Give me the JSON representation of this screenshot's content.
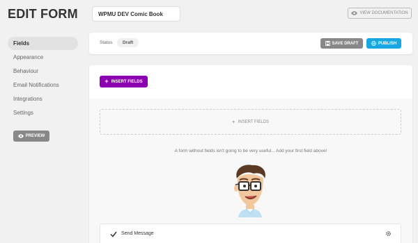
{
  "header": {
    "title": "EDIT FORM",
    "form_name": "WPMU DEV Comic Book",
    "view_docs_label": "VIEW DOCUMENTATION"
  },
  "sidebar": {
    "items": [
      {
        "label": "Fields",
        "active": true
      },
      {
        "label": "Appearance",
        "active": false
      },
      {
        "label": "Behaviour",
        "active": false
      },
      {
        "label": "Email Notifications",
        "active": false
      },
      {
        "label": "Integrations",
        "active": false
      },
      {
        "label": "Settings",
        "active": false
      }
    ],
    "preview_label": "PREVIEW"
  },
  "status_bar": {
    "status_label": "Status",
    "status_value": "Draft",
    "save_draft_label": "SAVE DRAFT",
    "publish_label": "PUBLISH"
  },
  "builder": {
    "insert_fields_label": "INSERT FIELDS",
    "dropzone_label": "INSERT FIELDS",
    "empty_message": "A form without fields isn't going to be very useful... Add your first field above!",
    "fields": [
      {
        "label": "Send Message"
      }
    ]
  },
  "colors": {
    "publish": "#17a8e3",
    "insert_fields": "#8d00b1",
    "gray_button": "#888888"
  }
}
